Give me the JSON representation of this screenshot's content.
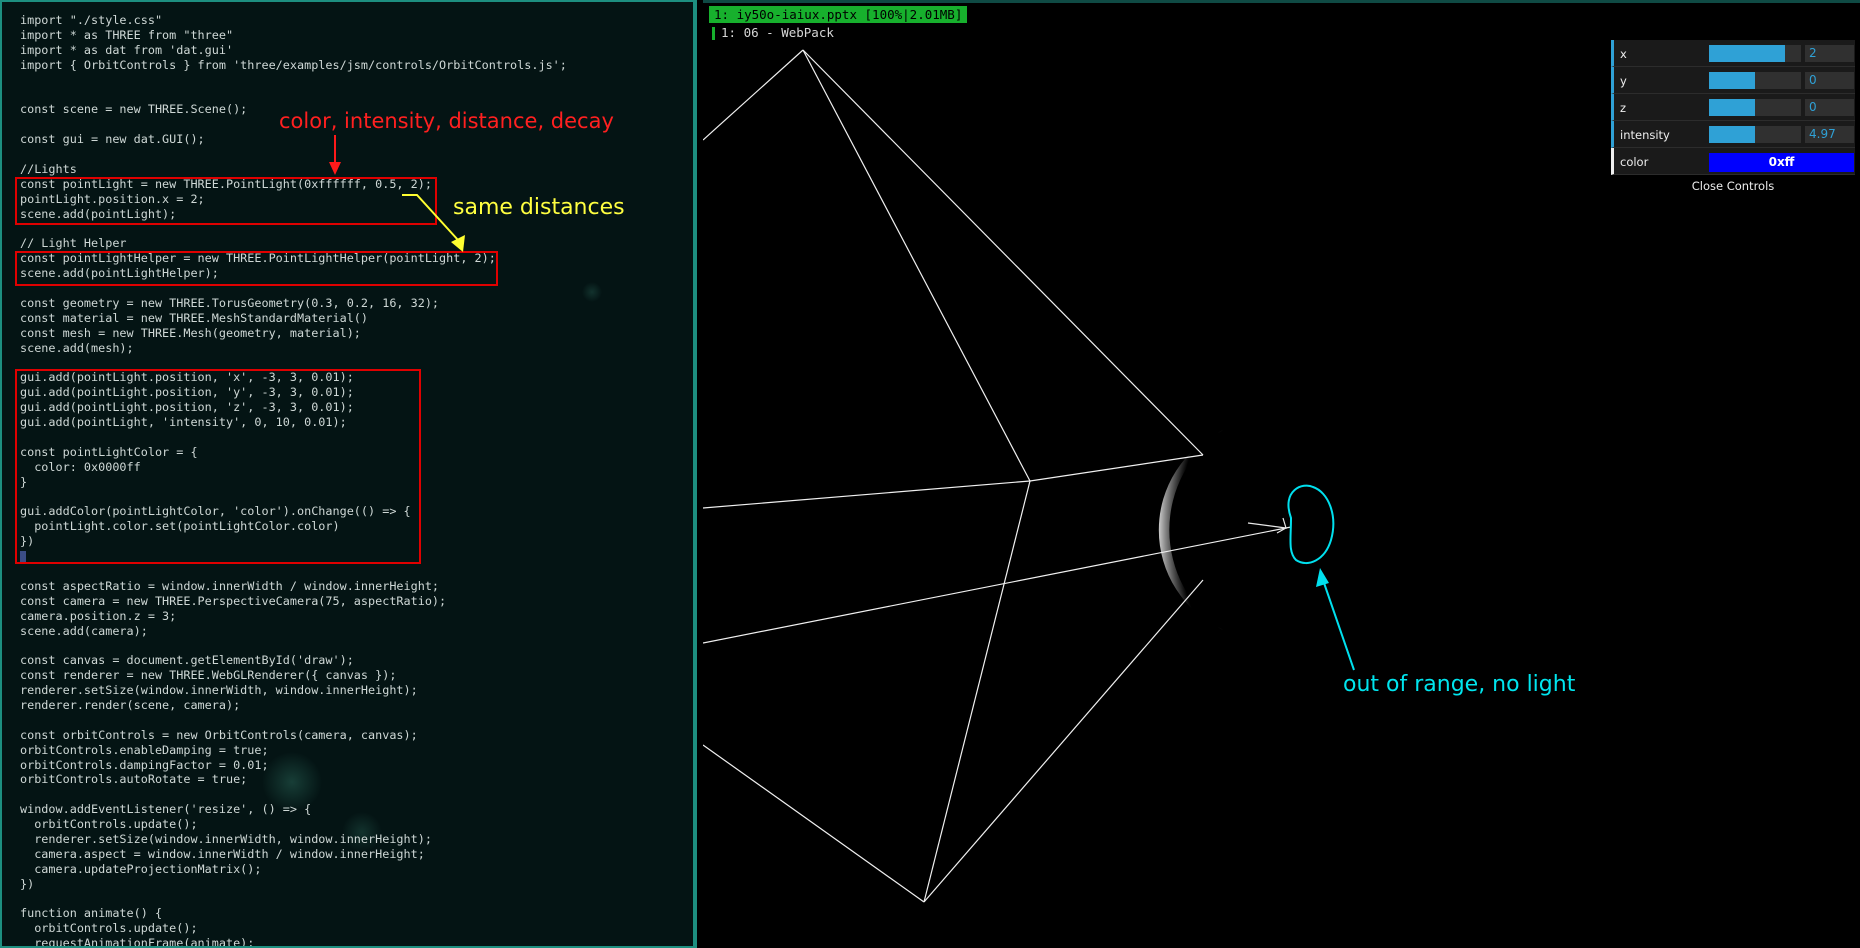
{
  "editor": {
    "lines": [
      "import \"./style.css\"",
      "import * as THREE from \"three\"",
      "import * as dat from 'dat.gui'",
      "import { OrbitControls } from 'three/examples/jsm/controls/OrbitControls.js';",
      "",
      "",
      "const scene = new THREE.Scene();",
      "",
      "const gui = new dat.GUI();",
      "",
      "//Lights",
      "const pointLight = new THREE.PointLight(0xffffff, 0.5, 2);",
      "pointLight.position.x = 2;",
      "scene.add(pointLight);",
      "",
      "// Light Helper",
      "const pointLightHelper = new THREE.PointLightHelper(pointLight, 2);",
      "scene.add(pointLightHelper);",
      "",
      "const geometry = new THREE.TorusGeometry(0.3, 0.2, 16, 32);",
      "const material = new THREE.MeshStandardMaterial()",
      "const mesh = new THREE.Mesh(geometry, material);",
      "scene.add(mesh);",
      "",
      "gui.add(pointLight.position, 'x', -3, 3, 0.01);",
      "gui.add(pointLight.position, 'y', -3, 3, 0.01);",
      "gui.add(pointLight.position, 'z', -3, 3, 0.01);",
      "gui.add(pointLight, 'intensity', 0, 10, 0.01);",
      "",
      "const pointLightColor = {",
      "  color: 0x0000ff",
      "}",
      "",
      "gui.addColor(pointLightColor, 'color').onChange(() => {",
      "  pointLight.color.set(pointLightColor.color)",
      "})",
      "",
      "",
      "const aspectRatio = window.innerWidth / window.innerHeight;",
      "const camera = new THREE.PerspectiveCamera(75, aspectRatio);",
      "camera.position.z = 3;",
      "scene.add(camera);",
      "",
      "const canvas = document.getElementById('draw');",
      "const renderer = new THREE.WebGLRenderer({ canvas });",
      "renderer.setSize(window.innerWidth, window.innerHeight);",
      "renderer.render(scene, camera);",
      "",
      "const orbitControls = new OrbitControls(camera, canvas);",
      "orbitControls.enableDamping = true;",
      "orbitControls.dampingFactor = 0.01;",
      "orbitControls.autoRotate = true;",
      "",
      "window.addEventListener('resize', () => {",
      "  orbitControls.update();",
      "  renderer.setSize(window.innerWidth, window.innerHeight);",
      "  camera.aspect = window.innerWidth / window.innerHeight;",
      "  camera.updateProjectionMatrix();",
      "})",
      "",
      "function animate() {",
      "  orbitControls.update();",
      "  requestAnimationFrame(animate);"
    ]
  },
  "annotations": {
    "params": "color, intensity, distance, decay",
    "same_distances": "same distances",
    "out_of_range": "out of range, no light"
  },
  "viewer": {
    "tab_title": "1: iy50o-iaiux.pptx [100%|2.01MB]",
    "subtitle": "1: 06 - WebPack"
  },
  "gui": {
    "controls": [
      {
        "label": "x",
        "value": "2",
        "fill": 0.83
      },
      {
        "label": "y",
        "value": "0",
        "fill": 0.5
      },
      {
        "label": "z",
        "value": "0",
        "fill": 0.5
      },
      {
        "label": "intensity",
        "value": "4.97",
        "fill": 0.497
      }
    ],
    "color_label": "color",
    "color_value": "0xff",
    "close_label": "Close Controls"
  },
  "colors": {
    "editor_bg": "#041414",
    "editor_border": "#1d8f80",
    "annotation_red": "#ff2020",
    "annotation_yellow": "#ffff40",
    "annotation_cyan": "#00e5ee",
    "gui_accent": "#2fa1d6",
    "swatch": "#0000ff",
    "tab_green": "#17b02d"
  }
}
